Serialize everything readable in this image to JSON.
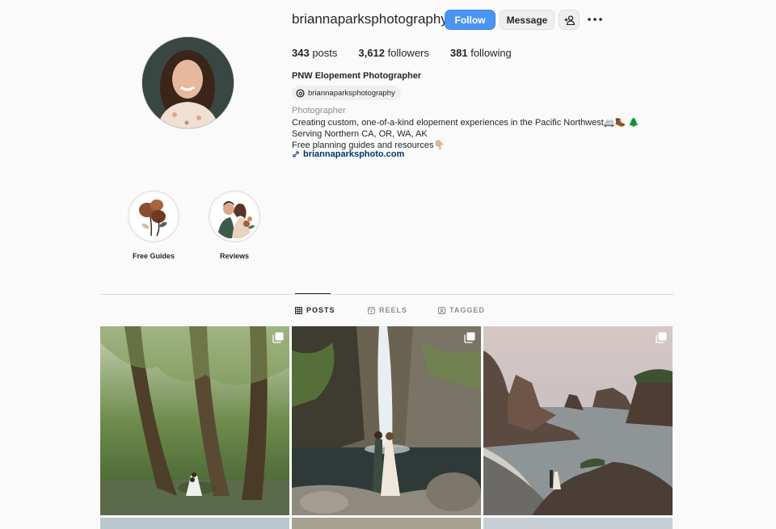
{
  "profile": {
    "username": "briannaparksphotography",
    "follow_label": "Follow",
    "message_label": "Message",
    "stats": [
      {
        "value": "343",
        "label": "posts"
      },
      {
        "value": "3,612",
        "label": "followers"
      },
      {
        "value": "381",
        "label": "following"
      }
    ],
    "full_name": "PNW Elopement Photographer",
    "threads_handle": "briannaparksphotography",
    "category": "Photographer",
    "bio_lines": [
      "Creating custom, one-of-a-kind elopement experiences in the Pacific Northwest🚐🥾 🌲",
      "Serving Northern CA, OR, WA, AK",
      "Free planning guides and resources👇🏼"
    ],
    "link": "briannaparksphoto.com"
  },
  "highlights": [
    {
      "label": "Free Guides"
    },
    {
      "label": "Reviews"
    }
  ],
  "tabs": [
    {
      "label": "POSTS",
      "active": true
    },
    {
      "label": "REELS",
      "active": false
    },
    {
      "label": "TAGGED",
      "active": false
    }
  ],
  "colors": {
    "accent": "#4a95f3",
    "link": "#00376b",
    "muted": "#8e8e8e"
  }
}
